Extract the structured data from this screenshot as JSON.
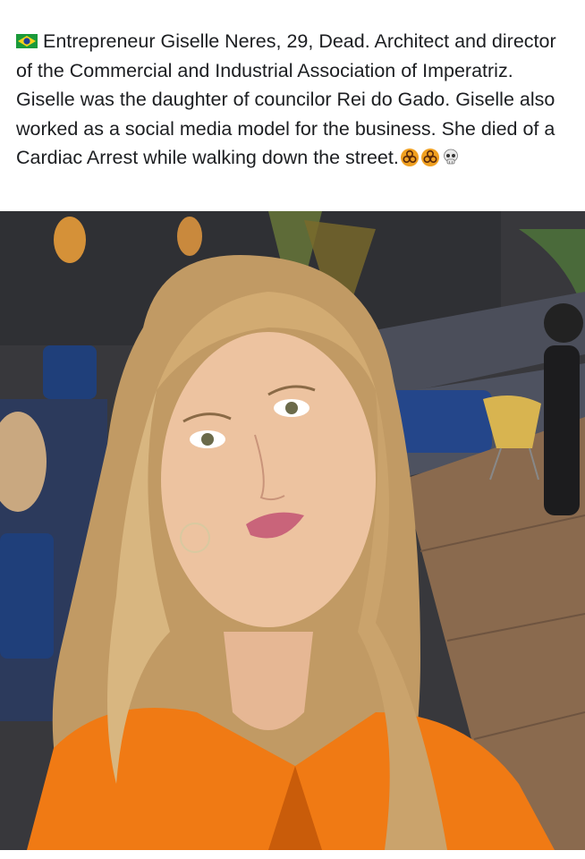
{
  "post": {
    "caption": "Entrepreneur Giselle Neres, 29, Dead. Architect and director of the Commercial and Industrial Association of Imperatriz. Giselle was the daughter of councilor Rei do Gado. Giselle also worked as a social media model for the business. She died of a Cardiac Arrest while walking down the street.",
    "leading_icon": "brazil-flag-icon",
    "trailing_icons": [
      "biohazard-icon",
      "biohazard-icon",
      "skull-icon"
    ]
  },
  "photo": {
    "colors": {
      "blouse": "#f07a14",
      "hair": "#c9a06a",
      "wall": "#3a3a3e",
      "floor": "#8a6a4e",
      "cushion": "#1f3f7a"
    }
  }
}
